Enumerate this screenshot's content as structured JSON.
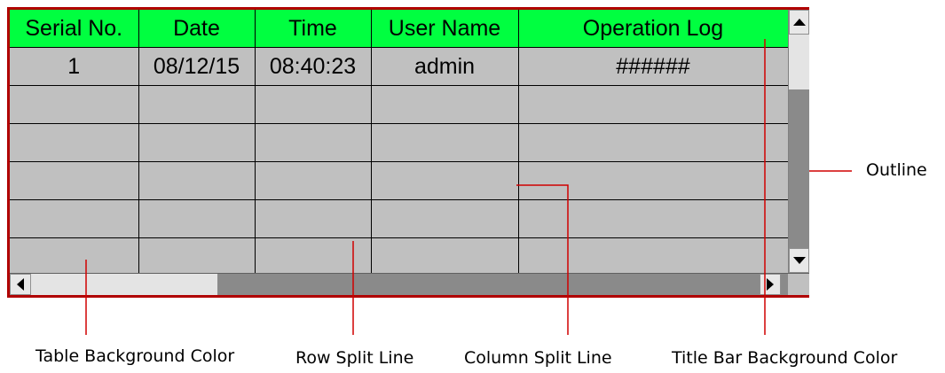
{
  "table": {
    "columns": [
      "Serial No.",
      "Date",
      "Time",
      "User Name",
      "Operation Log"
    ],
    "rows": [
      [
        "1",
        "08/12/15",
        "08:40:23",
        "admin",
        "######"
      ],
      [
        "",
        "",
        "",
        "",
        ""
      ],
      [
        "",
        "",
        "",
        "",
        ""
      ],
      [
        "",
        "",
        "",
        "",
        ""
      ],
      [
        "",
        "",
        "",
        "",
        ""
      ],
      [
        "",
        "",
        "",
        "",
        ""
      ]
    ]
  },
  "colors": {
    "title_bar_background": "#00ff40",
    "table_background": "#c0c0c0",
    "outline": "#b00000",
    "split_lines": "#000000"
  },
  "callouts": {
    "outline": "Outline",
    "table_background_color": "Table Background Color",
    "row_split_line": "Row Split Line",
    "column_split_line": "Column Split Line",
    "title_bar_background_color": "Title Bar Background Color"
  },
  "icons": {
    "scroll_up": "triangle-up-icon",
    "scroll_down": "triangle-down-icon",
    "scroll_left": "triangle-left-icon",
    "scroll_right": "triangle-right-icon"
  }
}
